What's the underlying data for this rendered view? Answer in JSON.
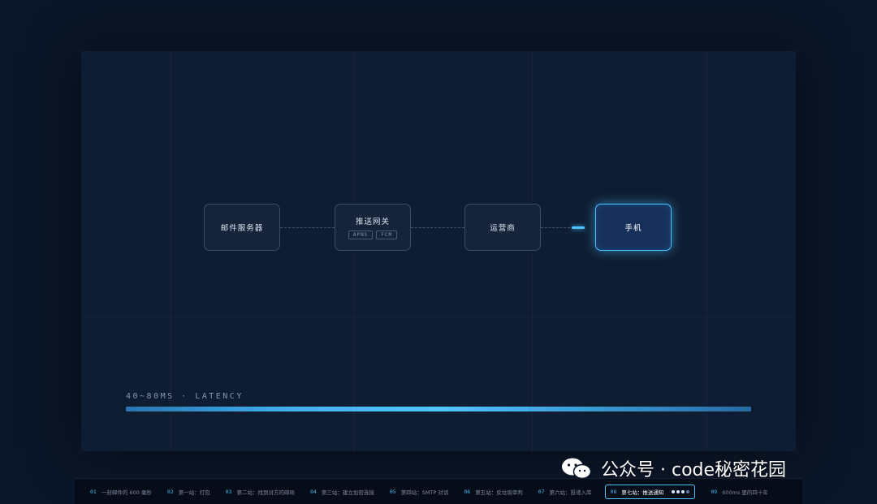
{
  "nodes": [
    {
      "label": "邮件服务器",
      "tags": []
    },
    {
      "label": "推送网关",
      "tags": [
        "APNS",
        "FCM"
      ]
    },
    {
      "label": "运营商",
      "tags": []
    },
    {
      "label": "手机",
      "tags": [],
      "active": true
    }
  ],
  "latency": {
    "label": "40~80MS · LATENCY",
    "progress": 1.0
  },
  "watermark": {
    "text": "公众号 · code秘密花园",
    "icon": "wechat-icon"
  },
  "footer": {
    "steps": [
      {
        "num": "01",
        "label": "一封邮件的 600 毫秒"
      },
      {
        "num": "02",
        "label": "第一站：打包"
      },
      {
        "num": "03",
        "label": "第二站：找到对方的邮局"
      },
      {
        "num": "04",
        "label": "第三站：建立加密连接"
      },
      {
        "num": "05",
        "label": "第四站：SMTP 对话"
      },
      {
        "num": "06",
        "label": "第五站：反垃圾审判"
      },
      {
        "num": "07",
        "label": "第六站：投递入库"
      },
      {
        "num": "08",
        "label": "第七站：推送通知",
        "active": true
      },
      {
        "num": "09",
        "label": "600ms 里的四十年"
      }
    ]
  },
  "colors": {
    "accent": "#4cc3ff",
    "background": "#0b1628",
    "stage": "#0f1d33"
  }
}
